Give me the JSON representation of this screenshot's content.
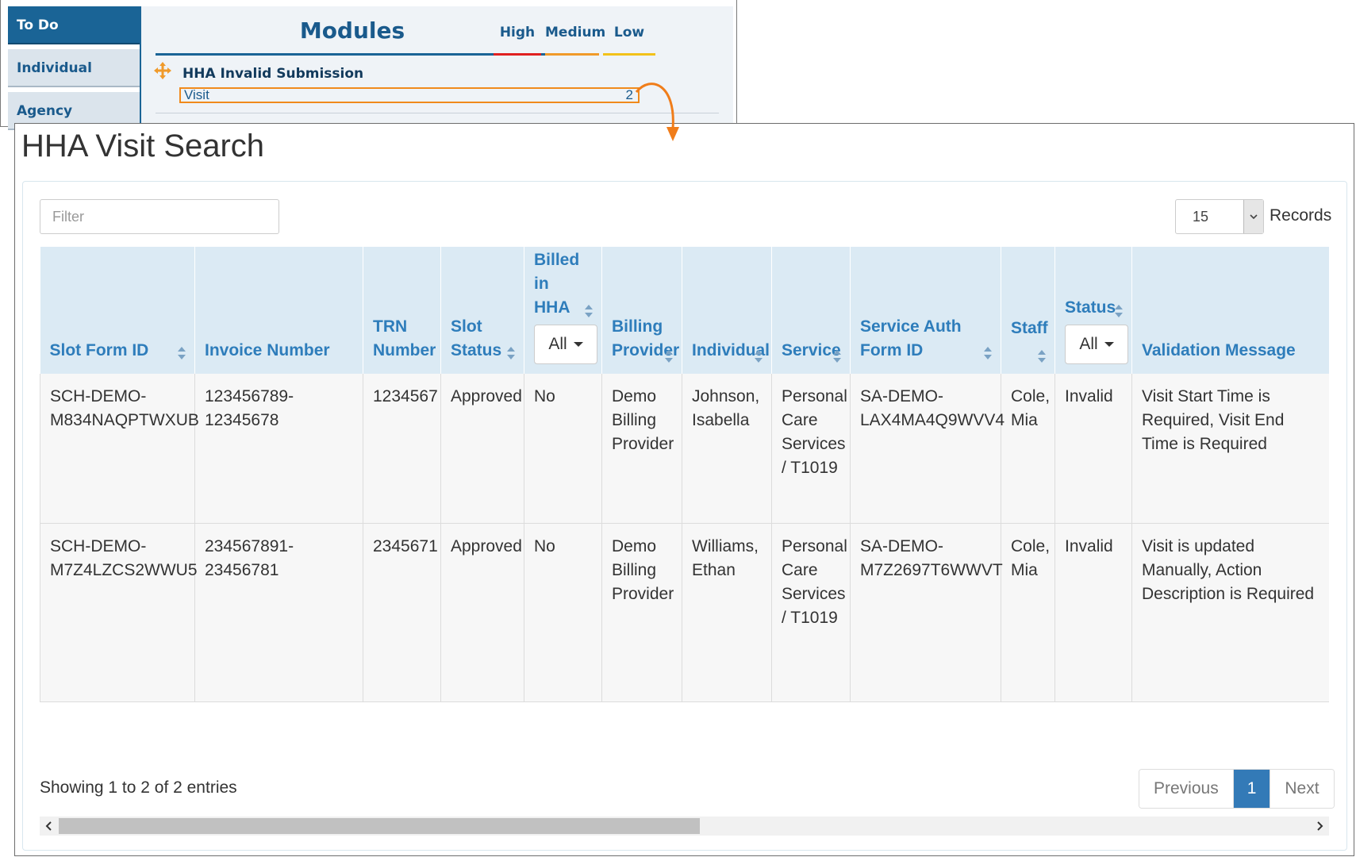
{
  "todo_window": {
    "sidebar": [
      {
        "label": "To Do",
        "active": true
      },
      {
        "label": "Individual",
        "active": false
      },
      {
        "label": "Agency",
        "active": false
      }
    ],
    "title": "Modules",
    "priority_tabs": [
      {
        "label": "High",
        "color": "#e02020"
      },
      {
        "label": "Medium",
        "color": "#f09a2a"
      },
      {
        "label": "Low",
        "color": "#f2c21a"
      }
    ],
    "alert_title": "HHA Invalid Submission",
    "visit_link": {
      "label": "Visit",
      "count": "2"
    }
  },
  "search_window": {
    "title": "HHA Visit Search",
    "filter_placeholder": "Filter",
    "records_value": "15",
    "records_label": "Records",
    "columns": [
      {
        "label": "Slot Form ID",
        "sortable": true
      },
      {
        "label": "Invoice Number",
        "sortable": false
      },
      {
        "label": "TRN Number",
        "sortable": false
      },
      {
        "label": "Slot Status",
        "sortable": true
      },
      {
        "label": "Billed in HHA",
        "sortable": true,
        "dropdown": "All"
      },
      {
        "label": "Billing Provider",
        "sortable": true
      },
      {
        "label": "Individual",
        "sortable": true
      },
      {
        "label": "Service",
        "sortable": true
      },
      {
        "label": "Service Auth Form ID",
        "sortable": true
      },
      {
        "label": "Staff",
        "sortable": true
      },
      {
        "label": "Status",
        "sortable": true,
        "dropdown": "All"
      },
      {
        "label": "Validation Message",
        "sortable": false
      }
    ],
    "rows": [
      [
        "SCH-DEMO-M834NAQPTWXUB",
        "123456789-12345678",
        "1234567",
        "Approved",
        "No",
        "Demo Billing Provider",
        "Johnson, Isabella",
        "Personal Care Services / T1019",
        "SA-DEMO-LAX4MA4Q9WVV4",
        "Cole, Mia",
        "Invalid",
        "Visit Start Time is Required, Visit End Time is Required"
      ],
      [
        "SCH-DEMO-M7Z4LZCS2WWU5",
        "234567891-23456781",
        "2345671",
        "Approved",
        "No",
        "Demo Billing Provider",
        "Williams, Ethan",
        "Personal Care Services / T1019",
        "SA-DEMO-M7Z2697T6WWVT",
        "Cole, Mia",
        "Invalid",
        "Visit is updated Manually, Action Description is Required"
      ]
    ],
    "info": "Showing 1 to 2 of 2 entries",
    "pagination": {
      "previous": "Previous",
      "current": "1",
      "next": "Next"
    },
    "accent_color": "#337ab7",
    "header_text_color": "#2e7dbb"
  }
}
